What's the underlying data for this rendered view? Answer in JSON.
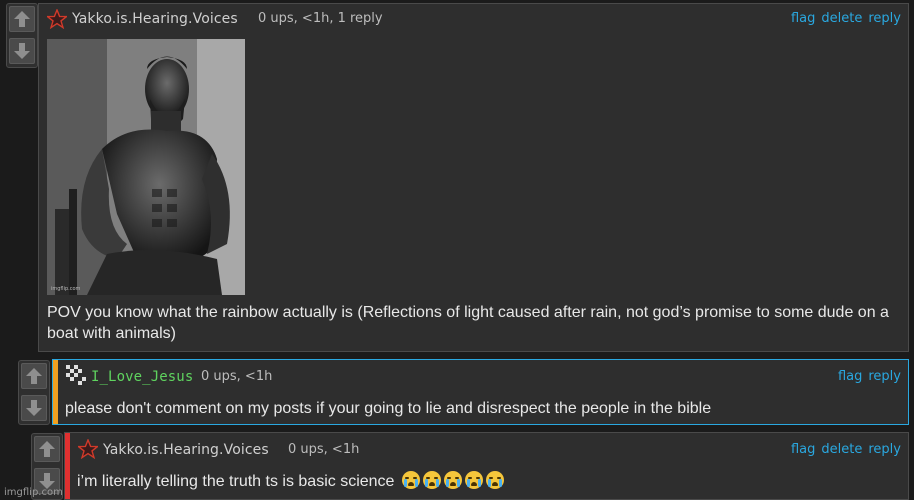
{
  "comments": [
    {
      "author": "Yakko.is.Hearing.Voices",
      "meta": "0 ups, <1h, 1 reply",
      "actions": [
        "flag",
        "delete",
        "reply"
      ],
      "text": "POV you know what the rainbow actually is (Reflections of light caused after rain, not god’s promise to some dude on a boat with animals)",
      "image_caption_small": "imgflip.com"
    },
    {
      "author": "I_Love_Jesus",
      "meta": "0 ups, <1h",
      "actions": [
        "flag",
        "reply"
      ],
      "text": "please don't comment on my posts if your going to lie and disrespect the people in the bible",
      "stripe_color": "#f0a020",
      "border_color": "#2aa8e0"
    },
    {
      "author": "Yakko.is.Hearing.Voices",
      "meta": "0 ups, <1h",
      "actions": [
        "flag",
        "delete",
        "reply"
      ],
      "text": "i’m literally telling the truth ts is basic science",
      "emoji_count": 5,
      "stripe_color": "#e03030"
    }
  ],
  "icons": {
    "upvote": "up-arrow-icon",
    "downvote": "down-arrow-icon",
    "user_badge": "star-badge-icon",
    "user_badge_alt": "pixel-badge-icon",
    "emoji": "loudly-crying-face-emoji"
  },
  "colors": {
    "link": "#2aa8e0",
    "green_user": "#5fd35f"
  },
  "footer": {
    "watermark": "imgflip.com"
  }
}
